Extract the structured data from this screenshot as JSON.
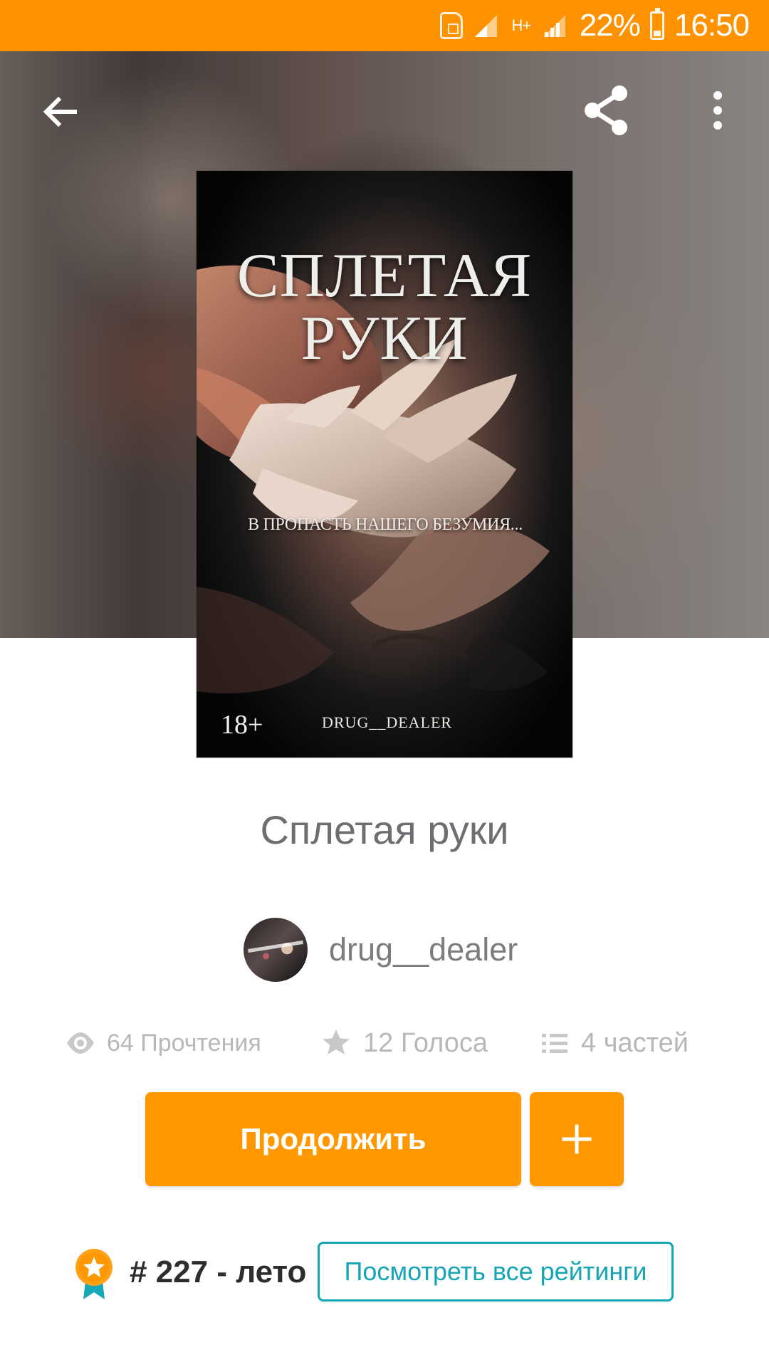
{
  "status_bar": {
    "battery": "22%",
    "time": "16:50",
    "network": "H+"
  },
  "toolbar": {
    "icons": [
      "back-icon",
      "share-icon",
      "more-icon"
    ]
  },
  "book_cover": {
    "title": "Сплетая руки",
    "subtitle": "В пропасть нашего безумия...",
    "age_rating": "18+",
    "author": "DRUG__DEALER"
  },
  "story": {
    "title": "Сплетая руки",
    "author": "drug__dealer"
  },
  "stats": {
    "reads": "64 Прочтения",
    "votes": "12 Голоса",
    "parts": "4 частей"
  },
  "actions": {
    "continue_label": "Продолжить",
    "add_icon": "plus-icon"
  },
  "ranking": {
    "text": "# 227 - лето",
    "link_label": "Посмотреть все рейтинги"
  },
  "colors": {
    "accent": "#ff9800",
    "link": "#16a5b6",
    "stats": "#b8b8b8"
  }
}
